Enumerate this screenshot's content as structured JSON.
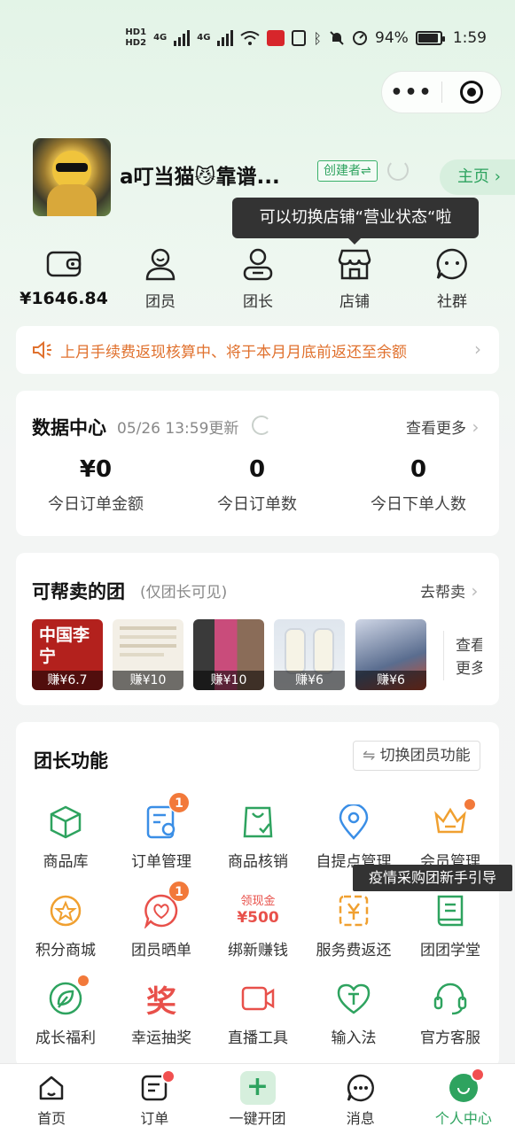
{
  "status_bar": {
    "hd1": "HD1",
    "hd2": "HD2",
    "net1": "4G",
    "net2": "4G",
    "battery": "94%",
    "time": "1:59"
  },
  "capsule": {
    "more": "•••",
    "close_icon": "target-icon"
  },
  "profile": {
    "name": "a叮当猫😼靠谱...",
    "creator_badge": "创建者⇌",
    "home_link": "主页"
  },
  "tooltip": "可以切换店铺“营业状态“啦",
  "quick_row": [
    {
      "label": "¥1646.84",
      "icon": "wallet-icon"
    },
    {
      "label": "团员",
      "icon": "member-icon"
    },
    {
      "label": "团长",
      "icon": "leader-icon"
    },
    {
      "label": "店铺",
      "icon": "store-icon"
    },
    {
      "label": "社群",
      "icon": "chat-group-icon"
    }
  ],
  "notice": {
    "text": "上月手续费返现核算中、将于本月月底前返还至余额"
  },
  "data_center": {
    "title": "数据中心",
    "updated": "05/26 13:59更新",
    "more": "查看更多",
    "stats": [
      {
        "value": "¥0",
        "label": "今日订单金额"
      },
      {
        "value": "0",
        "label": "今日订单数"
      },
      {
        "value": "0",
        "label": "今日下单人数"
      }
    ]
  },
  "help_sell": {
    "title": "可帮卖的团",
    "subtitle": "(仅团长可见)",
    "more": "去帮卖",
    "see_more_1": "查看",
    "see_more_2": "更多",
    "items": [
      {
        "earn": "赚¥6.7",
        "thumb_text": "中国李宁",
        "color": "#b3211d"
      },
      {
        "earn": "赚¥10",
        "thumb_text": "",
        "color": "#f3efe6"
      },
      {
        "earn": "赚¥10",
        "thumb_text": "",
        "color": "#8b5a63"
      },
      {
        "earn": "赚¥6",
        "thumb_text": "",
        "color": "#e9edf2"
      },
      {
        "earn": "赚¥6",
        "thumb_text": "",
        "color": "#5a6d8f"
      }
    ]
  },
  "leader_functions": {
    "title": "团长功能",
    "switch": "切换团员功能",
    "items": [
      {
        "label": "商品库",
        "icon": "cube-icon"
      },
      {
        "label": "订单管理",
        "icon": "order-manage-icon",
        "badge": "1"
      },
      {
        "label": "商品核销",
        "icon": "verify-bag-icon"
      },
      {
        "label": "自提点管理",
        "icon": "location-pin-icon"
      },
      {
        "label": "会员管理",
        "icon": "crown-icon"
      },
      {
        "label": "积分商城",
        "icon": "points-star-icon"
      },
      {
        "label": "团员晒单",
        "icon": "share-heart-icon",
        "badge": "1"
      },
      {
        "label": "绑新赚钱",
        "icon": "cash-reward-icon",
        "promo1": "领现金",
        "promo2": "¥500"
      },
      {
        "label": "服务费返还",
        "icon": "fee-return-icon"
      },
      {
        "label": "团团学堂",
        "icon": "book-icon"
      },
      {
        "label": "成长福利",
        "icon": "growth-leaf-icon"
      },
      {
        "label": "幸运抽奖",
        "icon": "lottery-icon",
        "glyph": "奖"
      },
      {
        "label": "直播工具",
        "icon": "live-camera-icon"
      },
      {
        "label": "输入法",
        "icon": "input-method-icon"
      },
      {
        "label": "官方客服",
        "icon": "headset-icon"
      }
    ]
  },
  "toast": "疫情采购团新手引导",
  "tabbar": [
    {
      "label": "首页",
      "icon": "home-icon"
    },
    {
      "label": "订单",
      "icon": "orders-icon"
    },
    {
      "label": "一键开团",
      "icon": "plus-icon"
    },
    {
      "label": "消息",
      "icon": "message-icon"
    },
    {
      "label": "个人中心",
      "icon": "profile-icon"
    }
  ],
  "colors": {
    "accent": "#2ea35f",
    "warning": "#e0712e",
    "badge": "#f2793a"
  }
}
